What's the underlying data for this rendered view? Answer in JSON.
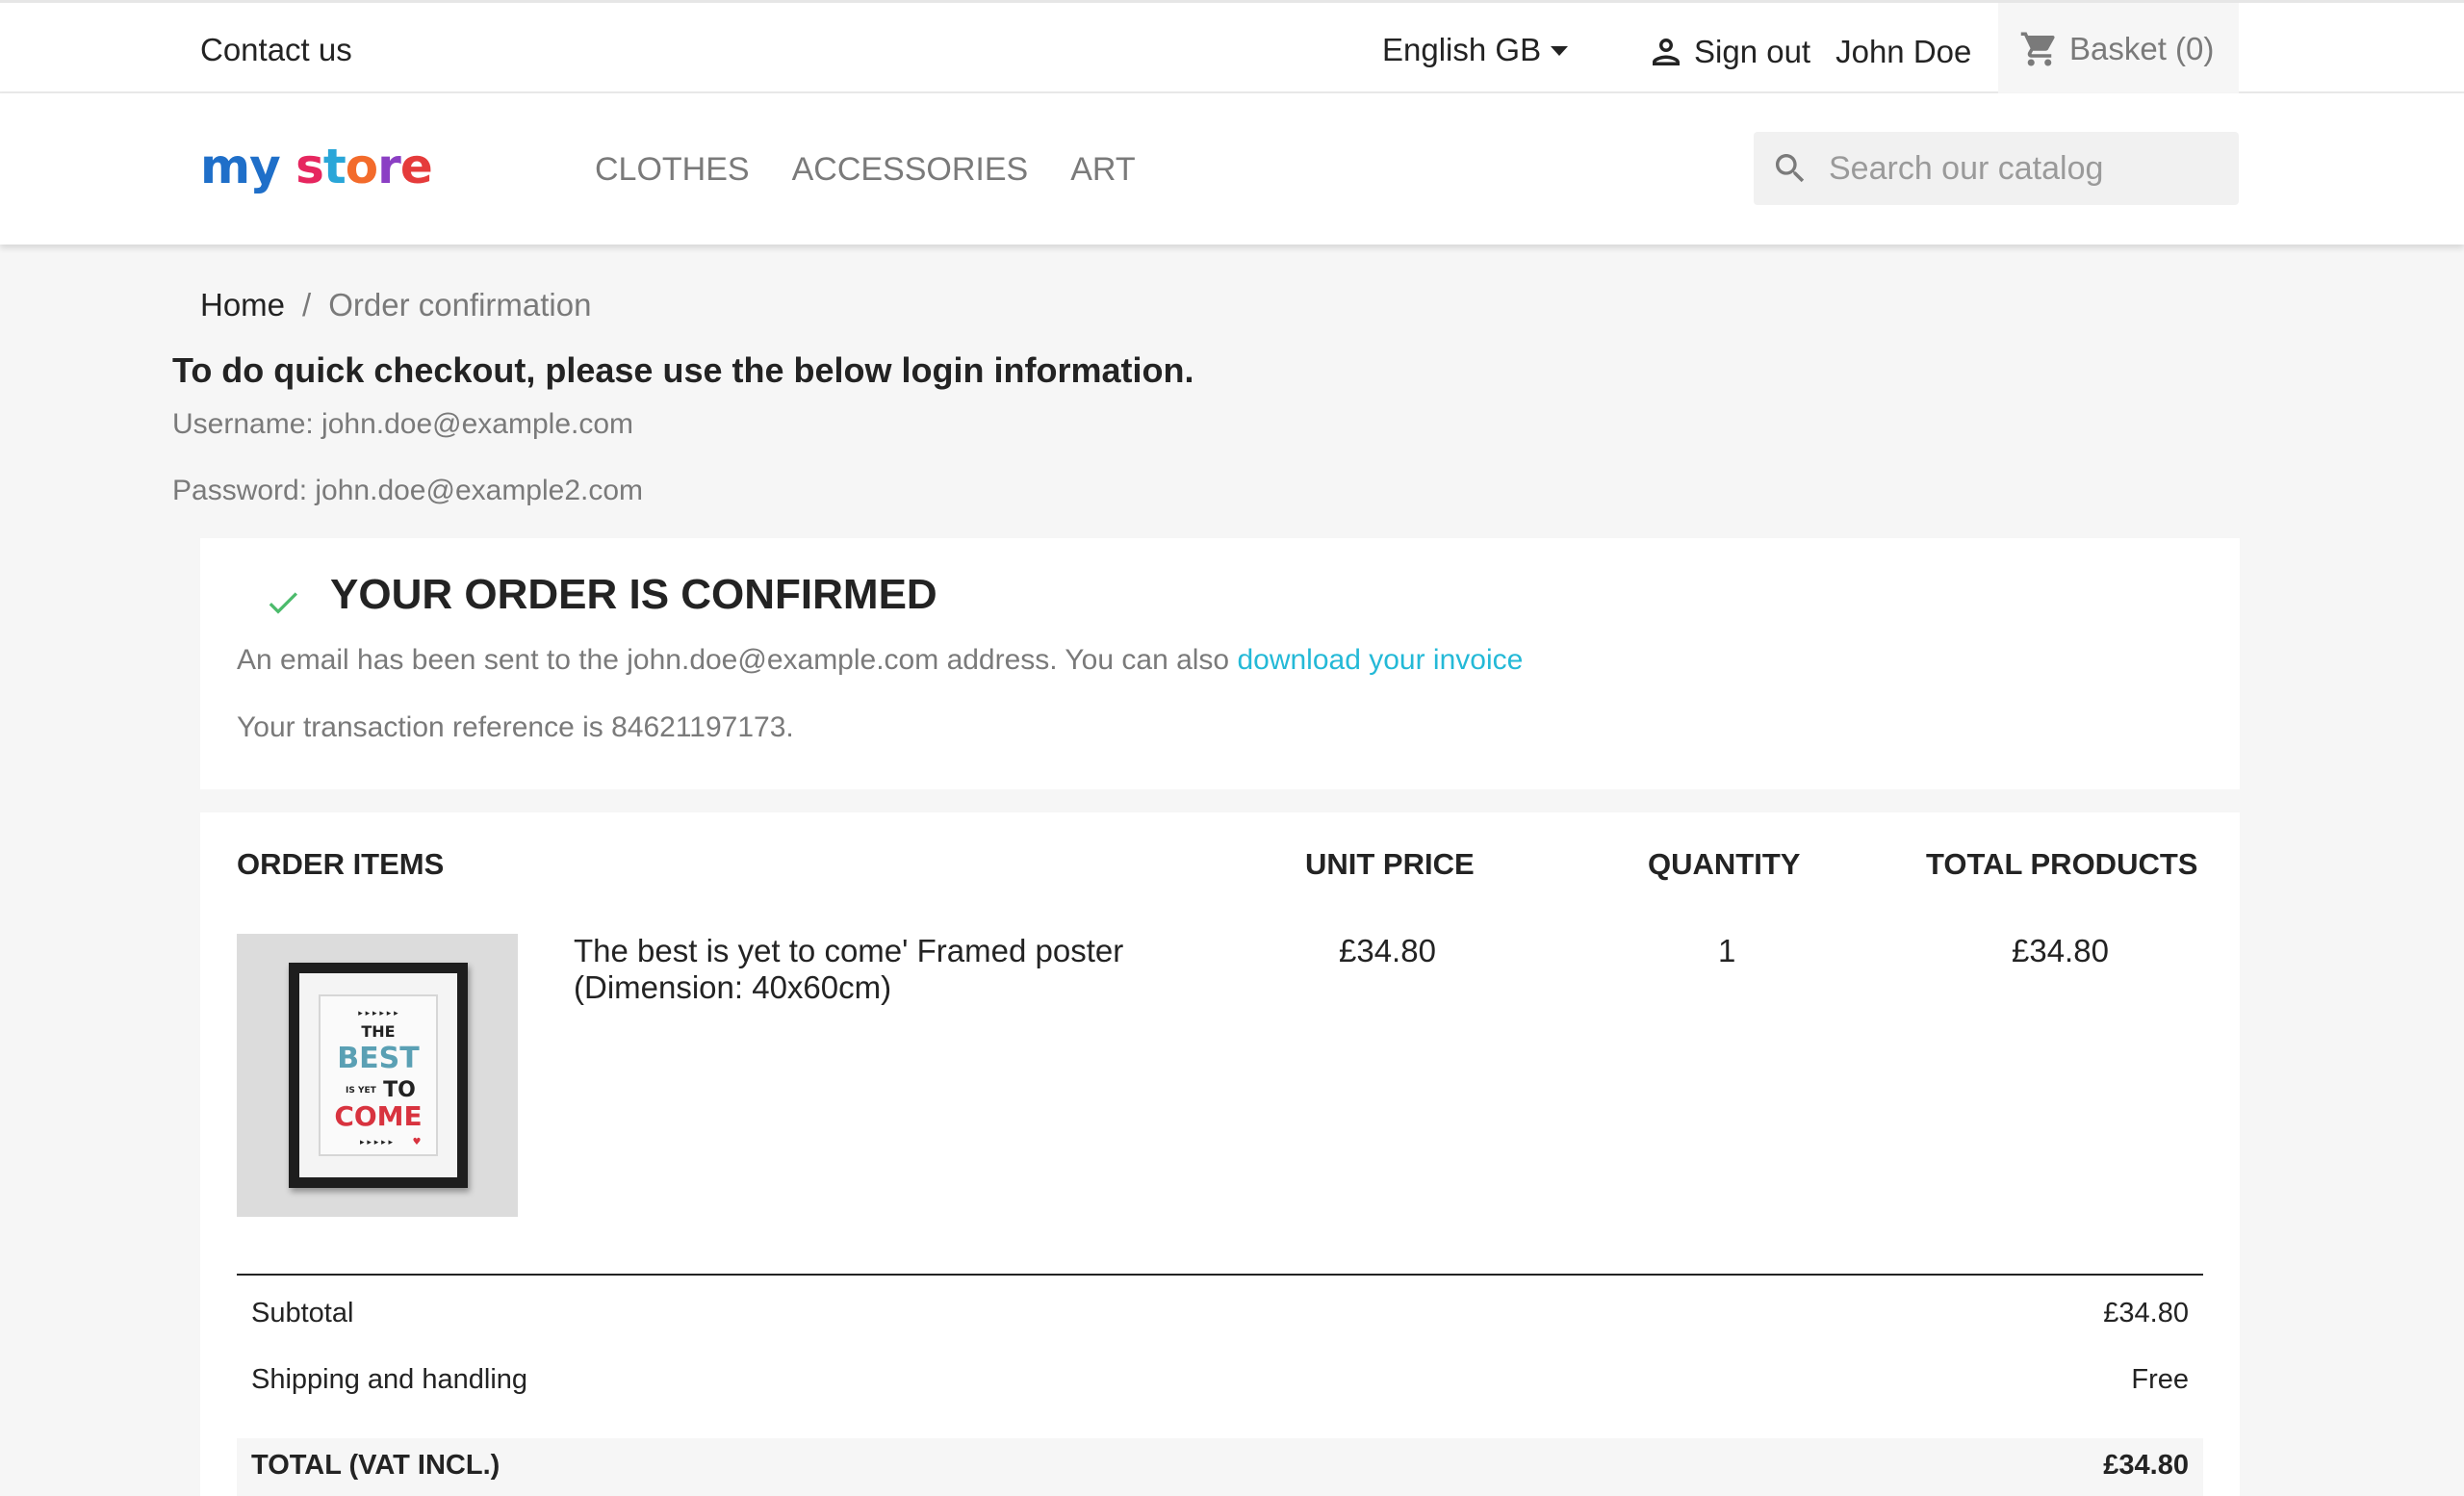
{
  "header": {
    "contact": "Contact us",
    "language": "English GB",
    "sign_out": "Sign out",
    "user_name": "John Doe",
    "basket": "Basket (0)"
  },
  "nav": {
    "logo": "my store",
    "menu": [
      "CLOTHES",
      "ACCESSORIES",
      "ART"
    ],
    "search_placeholder": "Search our catalog"
  },
  "breadcrumb": {
    "home": "Home",
    "separator": "/",
    "current": "Order confirmation"
  },
  "notice": {
    "heading": "To do quick checkout, please use the below login information.",
    "username": "Username: john.doe@example.com",
    "password": "Password: john.doe@example2.com"
  },
  "confirmation": {
    "title": "YOUR ORDER IS CONFIRMED",
    "email_text": "An email has been sent to the john.doe@example.com address. You can also ",
    "invoice_link": "download your invoice",
    "reference": "Your transaction reference is 84621197173."
  },
  "order": {
    "headers": {
      "items": "ORDER ITEMS",
      "unit_price": "UNIT PRICE",
      "quantity": "QUANTITY",
      "total": "TOTAL PRODUCTS"
    },
    "items": [
      {
        "name": "The best is yet to come' Framed poster (Dimension: 40x60cm)",
        "unit_price": "£34.80",
        "quantity": "1",
        "total": "£34.80",
        "image_text": [
          "THE",
          "BEST",
          "IS YET",
          "TO",
          "COME"
        ]
      }
    ],
    "totals": {
      "subtotal_label": "Subtotal",
      "subtotal": "£34.80",
      "shipping_label": "Shipping and handling",
      "shipping": "Free",
      "total_label": "TOTAL (VAT INCL.)",
      "total": "£34.80"
    }
  },
  "colors": {
    "accent_link": "#24b9d7",
    "check": "#4cbb6c",
    "background": "#f6f6f6"
  }
}
